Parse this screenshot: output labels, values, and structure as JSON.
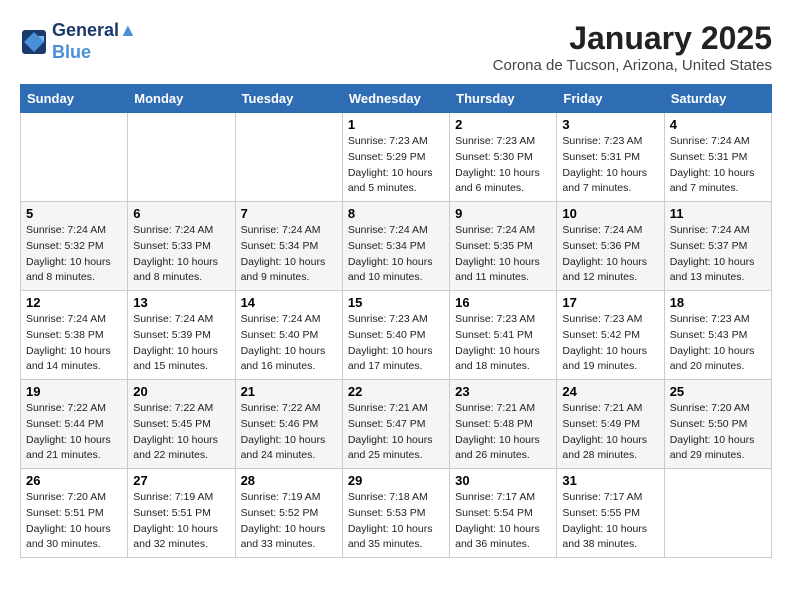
{
  "header": {
    "logo_line1": "General",
    "logo_line2": "Blue",
    "month_year": "January 2025",
    "location": "Corona de Tucson, Arizona, United States"
  },
  "days_of_week": [
    "Sunday",
    "Monday",
    "Tuesday",
    "Wednesday",
    "Thursday",
    "Friday",
    "Saturday"
  ],
  "weeks": [
    [
      {
        "day": "",
        "info": ""
      },
      {
        "day": "",
        "info": ""
      },
      {
        "day": "",
        "info": ""
      },
      {
        "day": "1",
        "info": "Sunrise: 7:23 AM\nSunset: 5:29 PM\nDaylight: 10 hours\nand 5 minutes."
      },
      {
        "day": "2",
        "info": "Sunrise: 7:23 AM\nSunset: 5:30 PM\nDaylight: 10 hours\nand 6 minutes."
      },
      {
        "day": "3",
        "info": "Sunrise: 7:23 AM\nSunset: 5:31 PM\nDaylight: 10 hours\nand 7 minutes."
      },
      {
        "day": "4",
        "info": "Sunrise: 7:24 AM\nSunset: 5:31 PM\nDaylight: 10 hours\nand 7 minutes."
      }
    ],
    [
      {
        "day": "5",
        "info": "Sunrise: 7:24 AM\nSunset: 5:32 PM\nDaylight: 10 hours\nand 8 minutes."
      },
      {
        "day": "6",
        "info": "Sunrise: 7:24 AM\nSunset: 5:33 PM\nDaylight: 10 hours\nand 8 minutes."
      },
      {
        "day": "7",
        "info": "Sunrise: 7:24 AM\nSunset: 5:34 PM\nDaylight: 10 hours\nand 9 minutes."
      },
      {
        "day": "8",
        "info": "Sunrise: 7:24 AM\nSunset: 5:34 PM\nDaylight: 10 hours\nand 10 minutes."
      },
      {
        "day": "9",
        "info": "Sunrise: 7:24 AM\nSunset: 5:35 PM\nDaylight: 10 hours\nand 11 minutes."
      },
      {
        "day": "10",
        "info": "Sunrise: 7:24 AM\nSunset: 5:36 PM\nDaylight: 10 hours\nand 12 minutes."
      },
      {
        "day": "11",
        "info": "Sunrise: 7:24 AM\nSunset: 5:37 PM\nDaylight: 10 hours\nand 13 minutes."
      }
    ],
    [
      {
        "day": "12",
        "info": "Sunrise: 7:24 AM\nSunset: 5:38 PM\nDaylight: 10 hours\nand 14 minutes."
      },
      {
        "day": "13",
        "info": "Sunrise: 7:24 AM\nSunset: 5:39 PM\nDaylight: 10 hours\nand 15 minutes."
      },
      {
        "day": "14",
        "info": "Sunrise: 7:24 AM\nSunset: 5:40 PM\nDaylight: 10 hours\nand 16 minutes."
      },
      {
        "day": "15",
        "info": "Sunrise: 7:23 AM\nSunset: 5:40 PM\nDaylight: 10 hours\nand 17 minutes."
      },
      {
        "day": "16",
        "info": "Sunrise: 7:23 AM\nSunset: 5:41 PM\nDaylight: 10 hours\nand 18 minutes."
      },
      {
        "day": "17",
        "info": "Sunrise: 7:23 AM\nSunset: 5:42 PM\nDaylight: 10 hours\nand 19 minutes."
      },
      {
        "day": "18",
        "info": "Sunrise: 7:23 AM\nSunset: 5:43 PM\nDaylight: 10 hours\nand 20 minutes."
      }
    ],
    [
      {
        "day": "19",
        "info": "Sunrise: 7:22 AM\nSunset: 5:44 PM\nDaylight: 10 hours\nand 21 minutes."
      },
      {
        "day": "20",
        "info": "Sunrise: 7:22 AM\nSunset: 5:45 PM\nDaylight: 10 hours\nand 22 minutes."
      },
      {
        "day": "21",
        "info": "Sunrise: 7:22 AM\nSunset: 5:46 PM\nDaylight: 10 hours\nand 24 minutes."
      },
      {
        "day": "22",
        "info": "Sunrise: 7:21 AM\nSunset: 5:47 PM\nDaylight: 10 hours\nand 25 minutes."
      },
      {
        "day": "23",
        "info": "Sunrise: 7:21 AM\nSunset: 5:48 PM\nDaylight: 10 hours\nand 26 minutes."
      },
      {
        "day": "24",
        "info": "Sunrise: 7:21 AM\nSunset: 5:49 PM\nDaylight: 10 hours\nand 28 minutes."
      },
      {
        "day": "25",
        "info": "Sunrise: 7:20 AM\nSunset: 5:50 PM\nDaylight: 10 hours\nand 29 minutes."
      }
    ],
    [
      {
        "day": "26",
        "info": "Sunrise: 7:20 AM\nSunset: 5:51 PM\nDaylight: 10 hours\nand 30 minutes."
      },
      {
        "day": "27",
        "info": "Sunrise: 7:19 AM\nSunset: 5:51 PM\nDaylight: 10 hours\nand 32 minutes."
      },
      {
        "day": "28",
        "info": "Sunrise: 7:19 AM\nSunset: 5:52 PM\nDaylight: 10 hours\nand 33 minutes."
      },
      {
        "day": "29",
        "info": "Sunrise: 7:18 AM\nSunset: 5:53 PM\nDaylight: 10 hours\nand 35 minutes."
      },
      {
        "day": "30",
        "info": "Sunrise: 7:17 AM\nSunset: 5:54 PM\nDaylight: 10 hours\nand 36 minutes."
      },
      {
        "day": "31",
        "info": "Sunrise: 7:17 AM\nSunset: 5:55 PM\nDaylight: 10 hours\nand 38 minutes."
      },
      {
        "day": "",
        "info": ""
      }
    ]
  ]
}
